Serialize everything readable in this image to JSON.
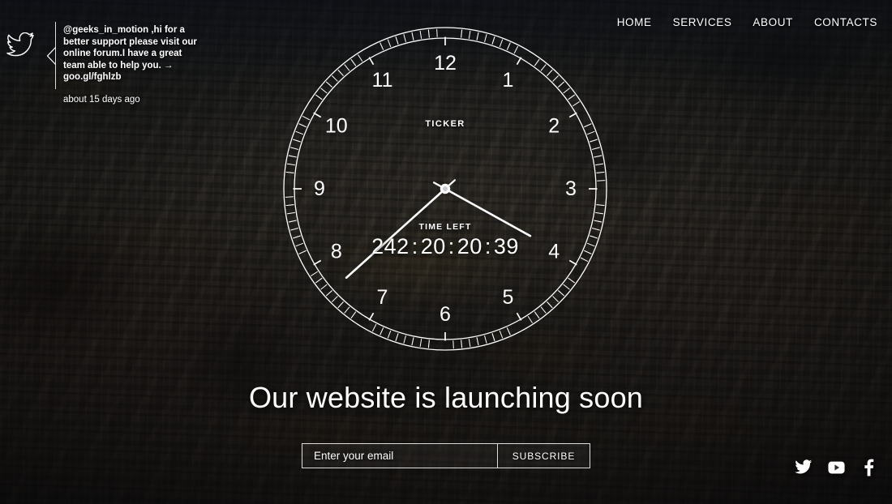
{
  "page": {
    "headline": "Our website is launching soon"
  },
  "nav": {
    "items": [
      {
        "label": "HOME",
        "name": "nav-item-home"
      },
      {
        "label": "SERVICES",
        "name": "nav-item-services"
      },
      {
        "label": "ABOUT",
        "name": "nav-item-about"
      },
      {
        "label": "CONTACTS",
        "name": "nav-item-contacts"
      }
    ]
  },
  "tweet": {
    "icon": "twitter-bird-icon",
    "handle": "@geeks_in_motion",
    "body": " ,hi for a better support please visit our online forum.I have a great team able to help you. → ",
    "link": "goo.gl/fghlzb",
    "timestamp": "about 15 days ago"
  },
  "clock": {
    "ticker_label": "TICKER",
    "time_left_label": "TIME LEFT",
    "numerals": [
      "12",
      "1",
      "2",
      "3",
      "4",
      "5",
      "6",
      "7",
      "8",
      "9",
      "10",
      "11"
    ],
    "countdown": {
      "days": "242",
      "hours": "20",
      "minutes": "20",
      "seconds": "39",
      "separator": ":",
      "display": "242 : 20 : 20 : 39"
    },
    "hands": {
      "long_hand_angle_deg": 228,
      "short_hand_angle_deg": 119
    },
    "stroke_color": "#ffffff"
  },
  "subscribe": {
    "email_placeholder": "Enter your email",
    "email_value": "",
    "button_label": "SUBSCRIBE"
  },
  "social": {
    "items": [
      {
        "label": "Twitter",
        "name": "social-twitter-icon"
      },
      {
        "label": "YouTube",
        "name": "social-youtube-icon"
      },
      {
        "label": "Facebook",
        "name": "social-facebook-icon"
      }
    ]
  },
  "colors": {
    "text": "#ffffff",
    "overlay": "#1a1c22"
  }
}
